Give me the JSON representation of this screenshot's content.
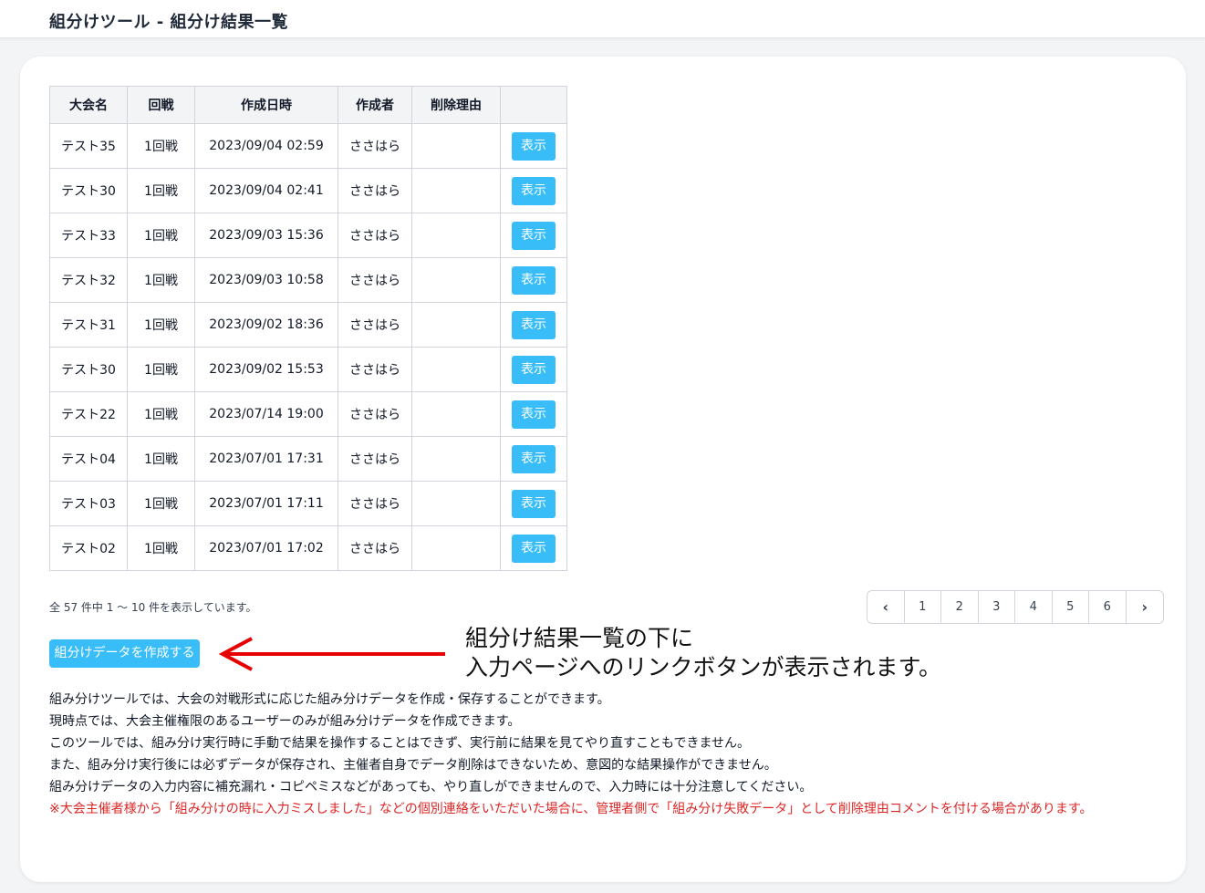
{
  "header": {
    "title": "組分けツール - 組分け結果一覧"
  },
  "table": {
    "headers": [
      "大会名",
      "回戦",
      "作成日時",
      "作成者",
      "削除理由",
      ""
    ],
    "rows": [
      {
        "name": "テスト35",
        "round": "1回戦",
        "date": "2023/09/04 02:59",
        "author": "ささはら",
        "reason": "",
        "action": "表示"
      },
      {
        "name": "テスト30",
        "round": "1回戦",
        "date": "2023/09/04 02:41",
        "author": "ささはら",
        "reason": "",
        "action": "表示"
      },
      {
        "name": "テスト33",
        "round": "1回戦",
        "date": "2023/09/03 15:36",
        "author": "ささはら",
        "reason": "",
        "action": "表示"
      },
      {
        "name": "テスト32",
        "round": "1回戦",
        "date": "2023/09/03 10:58",
        "author": "ささはら",
        "reason": "",
        "action": "表示"
      },
      {
        "name": "テスト31",
        "round": "1回戦",
        "date": "2023/09/02 18:36",
        "author": "ささはら",
        "reason": "",
        "action": "表示"
      },
      {
        "name": "テスト30",
        "round": "1回戦",
        "date": "2023/09/02 15:53",
        "author": "ささはら",
        "reason": "",
        "action": "表示"
      },
      {
        "name": "テスト22",
        "round": "1回戦",
        "date": "2023/07/14 19:00",
        "author": "ささはら",
        "reason": "",
        "action": "表示"
      },
      {
        "name": "テスト04",
        "round": "1回戦",
        "date": "2023/07/01 17:31",
        "author": "ささはら",
        "reason": "",
        "action": "表示"
      },
      {
        "name": "テスト03",
        "round": "1回戦",
        "date": "2023/07/01 17:11",
        "author": "ささはら",
        "reason": "",
        "action": "表示"
      },
      {
        "name": "テスト02",
        "round": "1回戦",
        "date": "2023/07/01 17:02",
        "author": "ささはら",
        "reason": "",
        "action": "表示"
      }
    ]
  },
  "summary": "全 57 件中 1 〜 10 件を表示しています。",
  "pagination": {
    "prev_icon": "chevron-left-icon",
    "pages": [
      "1",
      "2",
      "3",
      "4",
      "5",
      "6"
    ],
    "next_icon": "chevron-right-icon"
  },
  "create_button": "組分けデータを作成する",
  "annotation": {
    "line1": "組分け結果一覧の下に",
    "line2": "入力ページへのリンクボタンが表示されます。",
    "arrow_color": "#e60000"
  },
  "notes": [
    "組み分けツールでは、大会の対戦形式に応じた組み分けデータを作成・保存することができます。",
    "現時点では、大会主催権限のあるユーザーのみが組み分けデータを作成できます。",
    "このツールでは、組み分け実行時に手動で結果を操作することはできず、実行前に結果を見てやり直すこともできません。",
    "また、組み分け実行後には必ずデータが保存され、主催者自身でデータ削除はできないため、意図的な結果操作ができません。",
    "組み分けデータの入力内容に補充漏れ・コピペミスなどがあっても、やり直しができませんので、入力時には十分注意してください。"
  ],
  "warning": "※大会主催者様から「組み分けの時に入力ミスしました」などの個別連絡をいただいた場合に、管理者側で「組み分け失敗データ」として削除理由コメントを付ける場合があります。",
  "colors": {
    "accent": "#38bdf8",
    "warning": "#dc2626",
    "background": "#f3f4f6"
  }
}
